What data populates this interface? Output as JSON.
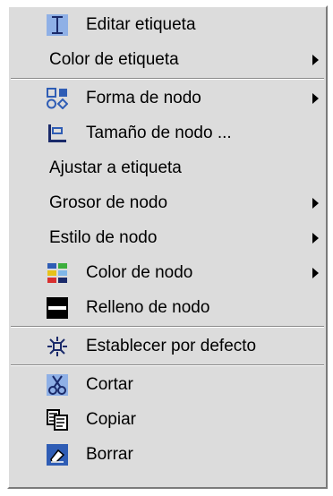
{
  "menu": {
    "items": [
      {
        "label": "Editar etiqueta",
        "icon": "text-cursor-icon"
      },
      {
        "label": "Color de etiqueta",
        "submenu": true
      },
      {
        "label": "Forma de nodo",
        "icon": "node-shapes-icon",
        "submenu": true
      },
      {
        "label": "Tamaño de nodo ...",
        "icon": "node-size-icon"
      },
      {
        "label": "Ajustar a etiqueta"
      },
      {
        "label": "Grosor de nodo",
        "submenu": true
      },
      {
        "label": "Estilo de nodo",
        "submenu": true
      },
      {
        "label": "Color de nodo",
        "icon": "color-palette-icon",
        "submenu": true
      },
      {
        "label": "Relleno de nodo",
        "icon": "fill-icon"
      },
      {
        "label": "Establecer por defecto",
        "icon": "set-default-icon"
      },
      {
        "label": "Cortar",
        "icon": "scissors-icon"
      },
      {
        "label": "Copiar",
        "icon": "copy-icon"
      },
      {
        "label": "Borrar",
        "icon": "eraser-icon"
      }
    ]
  },
  "colors": {
    "menu_bg": "#dcdcdc",
    "icon_blue": "#2f5db5",
    "text": "#000000"
  }
}
